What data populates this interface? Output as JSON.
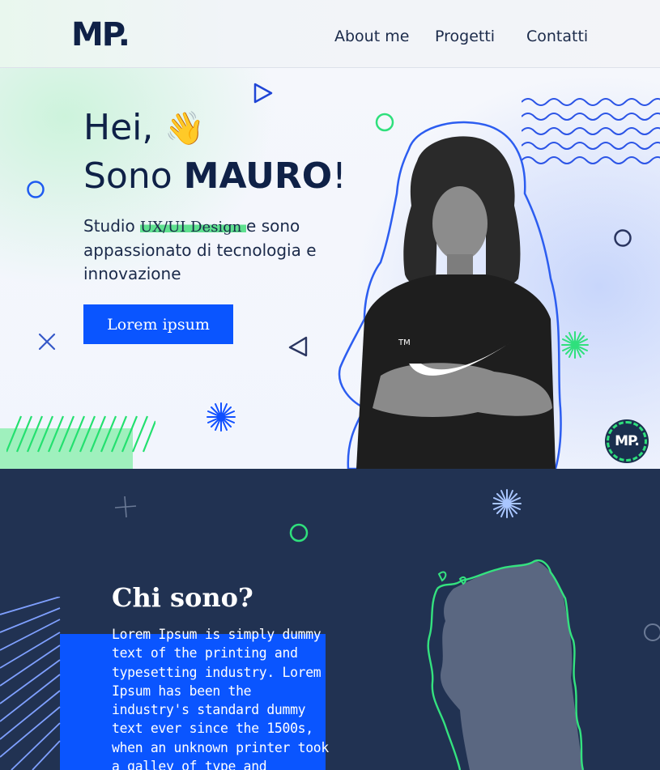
{
  "nav": {
    "logo": "MP.",
    "links": [
      "About me",
      "Progetti",
      "Contatti"
    ]
  },
  "hero": {
    "greeting": "Hei,",
    "greeting_emoji": "👋",
    "intro_prefix": "Sono ",
    "name": "MAURO",
    "intro_suffix": "!",
    "tagline_start": "Studio ",
    "tagline_highlight": "UX/UI Design ",
    "tagline_end": "e sono appassionato di tecnologia e innovazione",
    "cta_label": "Lorem ipsum",
    "badge": "MP."
  },
  "about": {
    "title": "Chi sono?",
    "body": "Lorem Ipsum is simply dummy text of the printing and typesetting industry. Lorem Ipsum has been the industry's standard dummy text ever since the 1500s, when an unknown printer took a galley of type and"
  },
  "colors": {
    "navy": "#0f2147",
    "accent_blue": "#0a55ff",
    "accent_green": "#2fe07c",
    "about_bg": "#213252"
  },
  "icons": [
    "play-triangle-icon",
    "circle-outline-icon",
    "cross-icon",
    "triangle-left-icon",
    "starburst-icon",
    "wave-lines-icon",
    "plus-icon",
    "hatch-lines-icon"
  ]
}
